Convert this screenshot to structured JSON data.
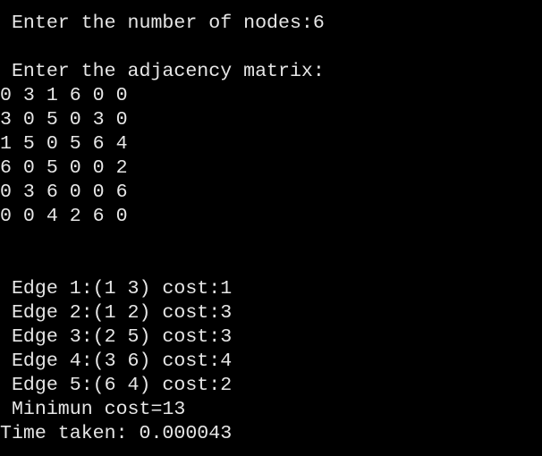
{
  "console": {
    "lines": [
      " Enter the number of nodes:6",
      "",
      " Enter the adjacency matrix:",
      "0 3 1 6 0 0",
      "3 0 5 0 3 0",
      "1 5 0 5 6 4",
      "6 0 5 0 0 2",
      "0 3 6 0 0 6",
      "0 0 4 2 6 0",
      "",
      "",
      " Edge 1:(1 3) cost:1",
      " Edge 2:(1 2) cost:3",
      " Edge 3:(2 5) cost:3",
      " Edge 4:(3 6) cost:4",
      " Edge 5:(6 4) cost:2",
      " Minimun cost=13",
      "Time taken: 0.000043"
    ]
  }
}
